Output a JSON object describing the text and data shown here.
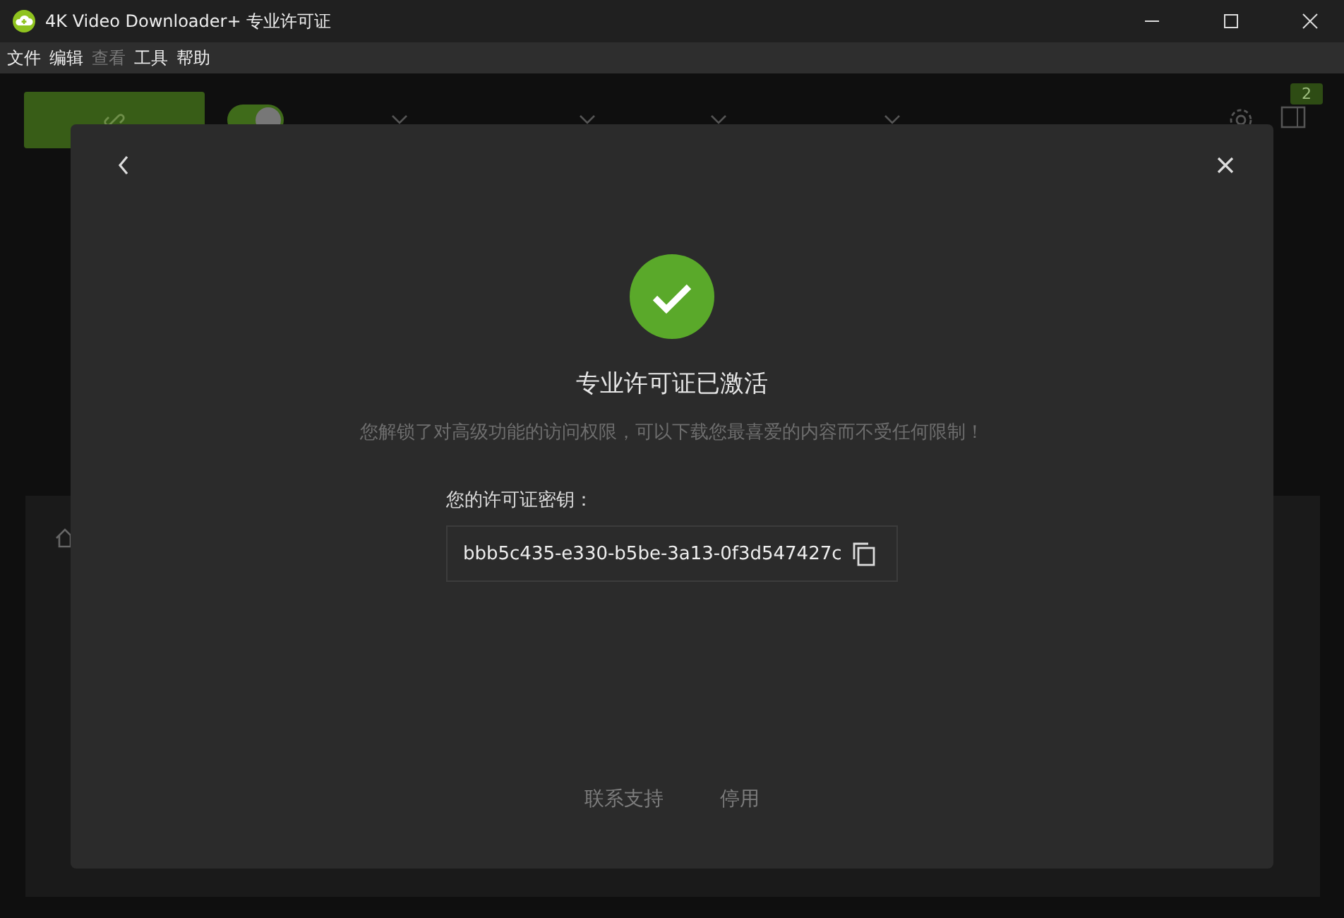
{
  "window": {
    "title": "4K Video Downloader+ 专业许可证"
  },
  "menu": [
    {
      "label": "文件",
      "disabled": false
    },
    {
      "label": "编辑",
      "disabled": false
    },
    {
      "label": "查看",
      "disabled": true
    },
    {
      "label": "工具",
      "disabled": false
    },
    {
      "label": "帮助",
      "disabled": false
    }
  ],
  "toolbar": {
    "smart_mode_on": true,
    "badge": "2"
  },
  "dialog": {
    "title": "专业许可证已激活",
    "message": "您解锁了对高级功能的访问权限，可以下载您最喜爱的内容而不受任何限制！",
    "key_label": "您的许可证密钥：",
    "key_value": "bbb5c435-e330-b5be-3a13-0f3d547427c",
    "actions": [
      "联系支持",
      "停用"
    ]
  }
}
